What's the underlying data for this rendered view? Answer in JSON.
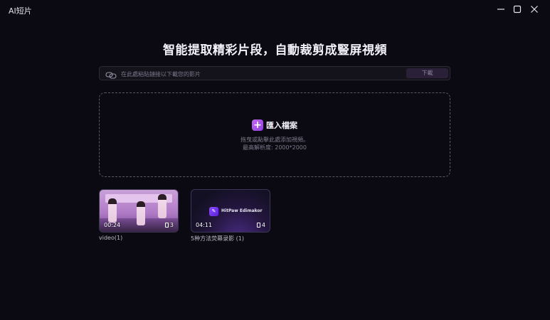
{
  "window": {
    "title": "AI短片",
    "controls": [
      "minimize-icon",
      "maximize-icon",
      "close-icon"
    ]
  },
  "headline": "智能提取精彩片段，自動裁剪成豎屏視頻",
  "url_bar": {
    "icon": "link-icon",
    "placeholder": "在此處粘貼鏈接以下載您的影片",
    "value": "",
    "download_label": "下載"
  },
  "drop_zone": {
    "icon": "plus-icon",
    "import_label": "匯入檔案",
    "hint_line1": "拖曳或點擊此處添加視頻。",
    "hint_line2": "最高解析度: 2000*2000"
  },
  "videos": [
    {
      "title": "video(1)",
      "duration": "00:24",
      "count": "3"
    },
    {
      "title": "5种方法荧幕录影 (1)",
      "duration": "04:11",
      "count": "4",
      "brand": "HitPaw Edimakor"
    }
  ],
  "colors": {
    "background": "#0b0a12",
    "accent": "#a855f7",
    "download_button": "#2a2038"
  }
}
